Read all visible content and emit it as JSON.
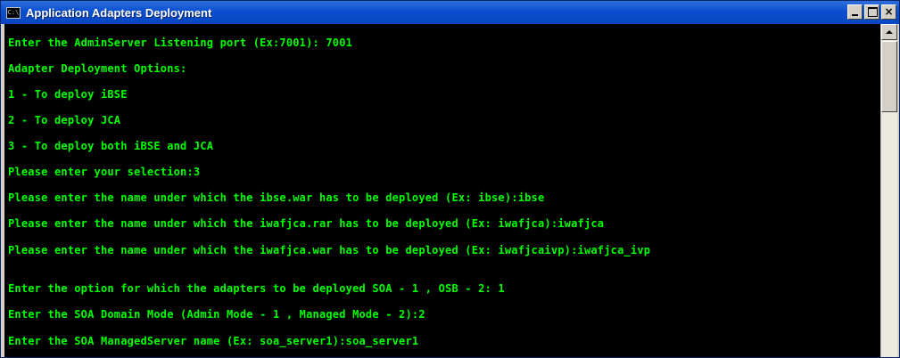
{
  "window": {
    "title": "Application Adapters Deployment",
    "icon_label": "C:\\",
    "buttons": {
      "minimize": "",
      "maximize": "",
      "close": "×"
    }
  },
  "console": {
    "text_color": "#00ff00",
    "background": "#000000",
    "lines": [
      "Enter the AdminServer Listening port (Ex:7001): 7001",
      "Adapter Deployment Options:",
      "1 - To deploy iBSE",
      "2 - To deploy JCA",
      "3 - To deploy both iBSE and JCA",
      "Please enter your selection:3",
      "Please enter the name under which the ibse.war has to be deployed (Ex: ibse):ibse",
      "Please enter the name under which the iwafjca.rar has to be deployed (Ex: iwafjca):iwafjca",
      "Please enter the name under which the iwafjca.war has to be deployed (Ex: iwafjcaivp):iwafjca_ivp",
      "Enter the option for which the adapters to be deployed SOA - 1 , OSB - 2: 1",
      "Enter the SOA Domain Mode (Admin Mode - 1 , Managed Mode - 2):2",
      "Enter the SOA ManagedServer name (Ex: soa_server1):soa_server1"
    ]
  }
}
